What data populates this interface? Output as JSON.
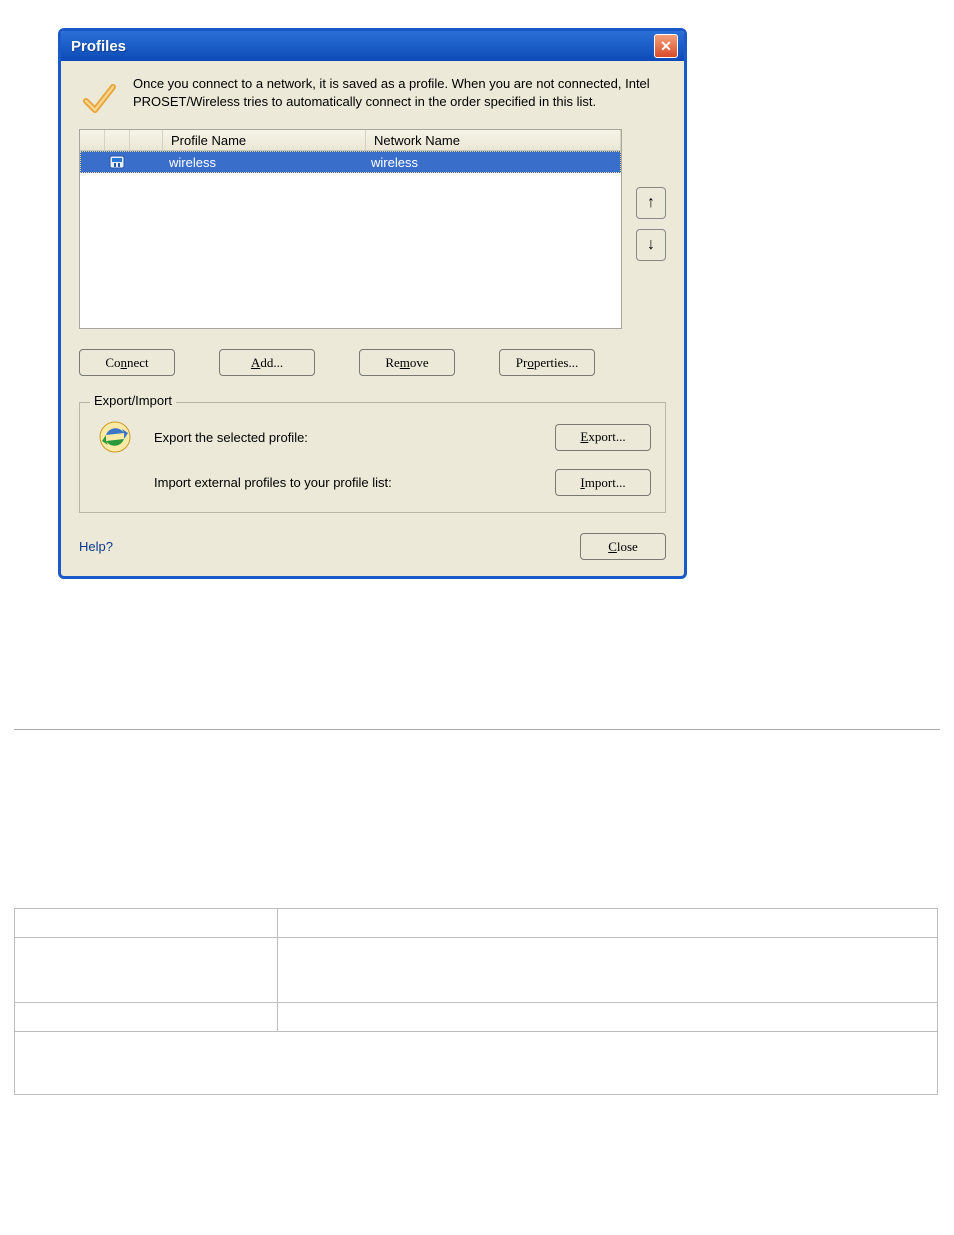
{
  "window": {
    "title": "Profiles",
    "intro": "Once you connect to a network, it is saved as a profile. When you are not connected, Intel PROSET/Wireless tries to automatically connect in the order specified in this list.",
    "headers": {
      "profile": "Profile Name",
      "network": "Network Name"
    },
    "row": {
      "profile": "wireless",
      "network": "wireless"
    },
    "buttons": {
      "connect_pre": "Co",
      "connect_u": "n",
      "connect_post": "nect",
      "add_u": "A",
      "add_post": "dd...",
      "remove_pre": "Re",
      "remove_u": "m",
      "remove_post": "ove",
      "props_pre": "Pr",
      "props_u": "o",
      "props_post": "perties..."
    },
    "group": {
      "legend": "Export/Import",
      "export_text": "Export the selected profile:",
      "import_text": "Import external profiles to your profile list:",
      "export_u": "E",
      "export_post": "xport...",
      "import_u": "I",
      "import_post": "mport..."
    },
    "help": "Help?",
    "close_u": "C",
    "close_post": "lose",
    "arrows": {
      "up": "↑",
      "down": "↓"
    }
  }
}
